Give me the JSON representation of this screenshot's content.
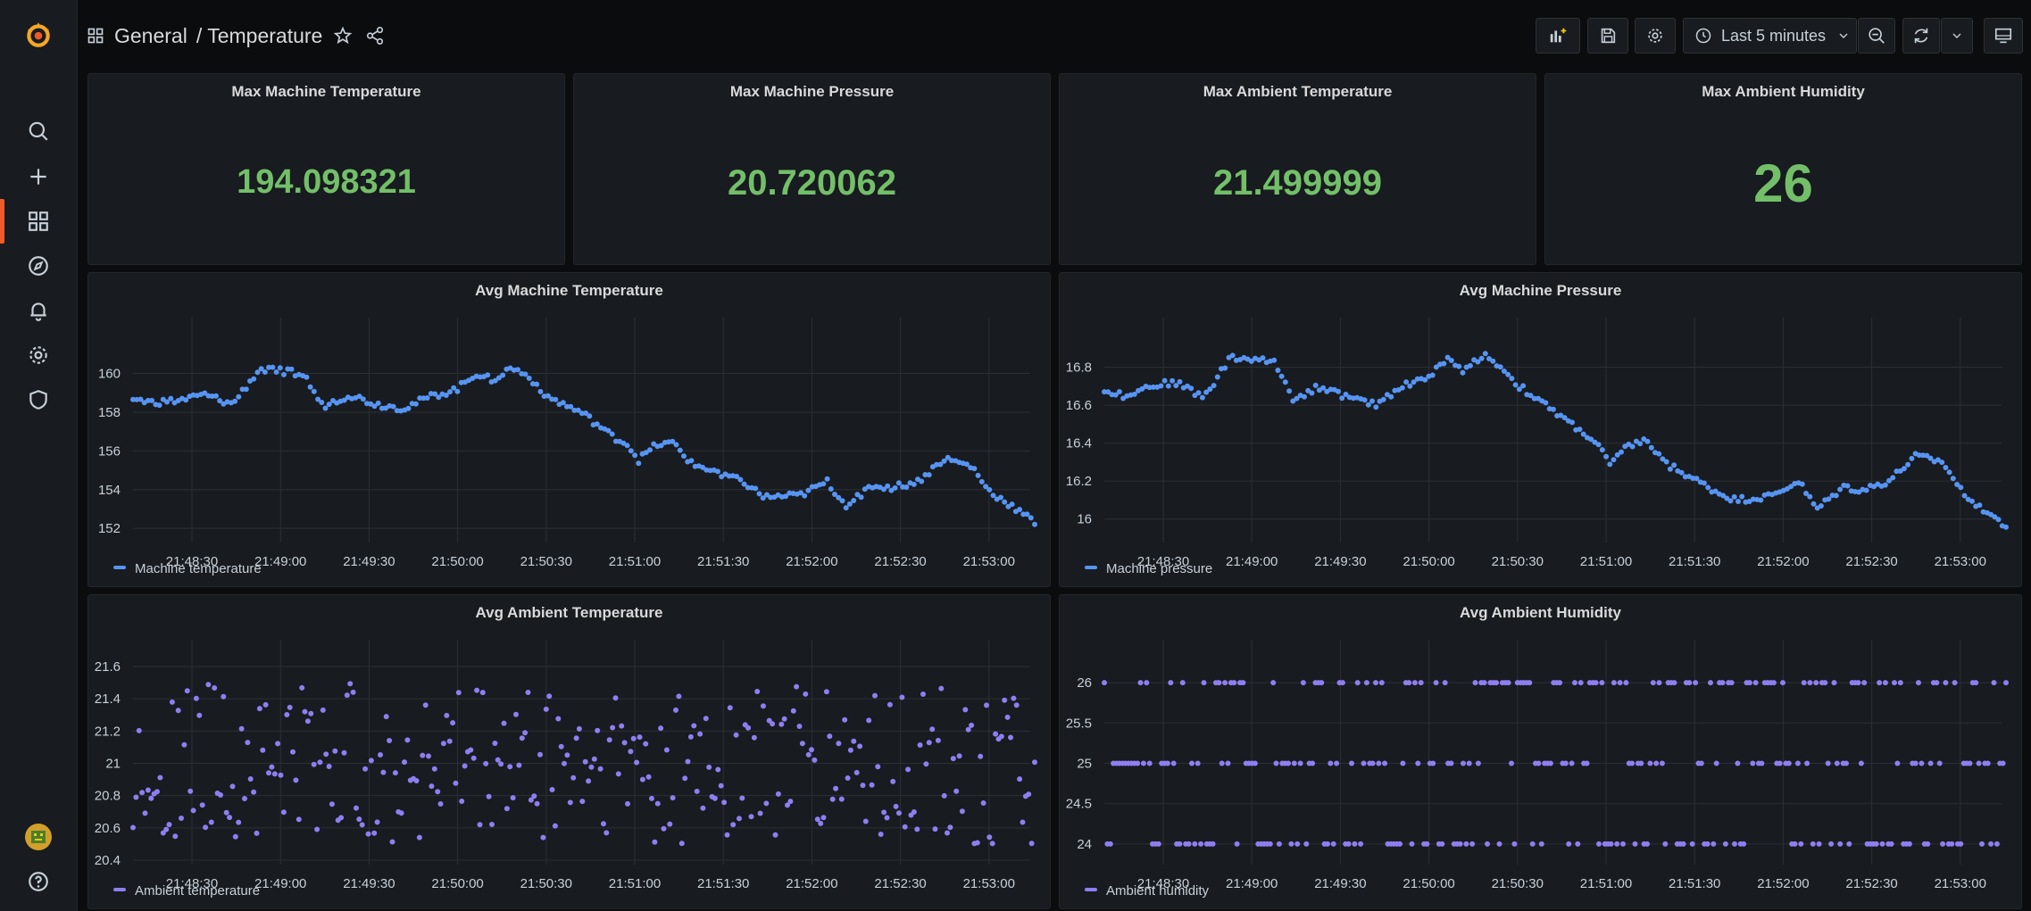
{
  "header": {
    "breadcrumb_folder": "General",
    "breadcrumb_separator": "/",
    "dashboard_title": "Temperature",
    "time_range_label": "Last 5 minutes"
  },
  "icons": {
    "logo": "grafana-logo",
    "search": "search-icon",
    "create": "plus-icon",
    "dashboards": "dashboards-grid-icon",
    "explore": "compass-icon",
    "alerting": "bell-icon",
    "configuration": "gear-icon",
    "server_admin": "shield-icon",
    "help": "question-icon"
  },
  "colors": {
    "stat_value": "#73bf69",
    "series_blue": "#5794f2",
    "series_purple": "#8f7ef2",
    "accent": "#f05a28"
  },
  "stats": [
    {
      "title": "Max Machine Temperature",
      "value": "194.098321"
    },
    {
      "title": "Max Machine Pressure",
      "value": "20.720062"
    },
    {
      "title": "Max Ambient Temperature",
      "value": "21.499999"
    },
    {
      "title": "Max Ambient Humidity",
      "value": "26"
    }
  ],
  "chart_data": [
    {
      "type": "scatter",
      "title": "Avg Machine Temperature",
      "x_ticks": [
        "21:48:30",
        "21:49:00",
        "21:49:30",
        "21:50:00",
        "21:50:30",
        "21:51:00",
        "21:51:30",
        "21:52:00",
        "21:52:30",
        "21:53:00"
      ],
      "y_ticks": [
        160,
        158,
        156,
        154,
        152
      ],
      "ylim": [
        151.5,
        161.5
      ],
      "grid": true,
      "legend_position": "bottom-left",
      "series": [
        {
          "name": "Machine temperature",
          "color": "#5794f2",
          "anchors": [
            [
              0,
              158.7
            ],
            [
              0.02,
              158.5
            ],
            [
              0.05,
              158.6
            ],
            [
              0.08,
              158.9
            ],
            [
              0.11,
              158.4
            ],
            [
              0.14,
              160.2
            ],
            [
              0.17,
              160.1
            ],
            [
              0.19,
              159.9
            ],
            [
              0.21,
              158.3
            ],
            [
              0.24,
              158.9
            ],
            [
              0.27,
              158.4
            ],
            [
              0.3,
              158.2
            ],
            [
              0.33,
              158.8
            ],
            [
              0.36,
              159.2
            ],
            [
              0.38,
              160
            ],
            [
              0.4,
              159.7
            ],
            [
              0.42,
              160.3
            ],
            [
              0.44,
              159.8
            ],
            [
              0.46,
              158.8
            ],
            [
              0.5,
              157.9
            ],
            [
              0.53,
              156.8
            ],
            [
              0.55,
              156.3
            ],
            [
              0.56,
              155.5
            ],
            [
              0.58,
              156.3
            ],
            [
              0.6,
              156.4
            ],
            [
              0.62,
              155.3
            ],
            [
              0.65,
              154.9
            ],
            [
              0.68,
              154.3
            ],
            [
              0.7,
              153.6
            ],
            [
              0.74,
              153.7
            ],
            [
              0.77,
              154.4
            ],
            [
              0.79,
              153.2
            ],
            [
              0.82,
              154.2
            ],
            [
              0.84,
              154.1
            ],
            [
              0.87,
              154.4
            ],
            [
              0.9,
              155.6
            ],
            [
              0.93,
              155.2
            ],
            [
              0.95,
              153.9
            ],
            [
              0.97,
              153.3
            ],
            [
              1,
              152.3
            ]
          ]
        }
      ]
    },
    {
      "type": "scatter",
      "title": "Avg Machine Pressure",
      "x_ticks": [
        "21:48:30",
        "21:49:00",
        "21:49:30",
        "21:50:00",
        "21:50:30",
        "21:51:00",
        "21:51:30",
        "21:52:00",
        "21:52:30",
        "21:53:00"
      ],
      "y_ticks": [
        16.8,
        16.6,
        16.4,
        16.2,
        16
      ],
      "ylim": [
        15.9,
        16.92
      ],
      "grid": true,
      "legend_position": "bottom-left",
      "series": [
        {
          "name": "Machine pressure",
          "color": "#5794f2",
          "anchors": [
            [
              0,
              16.68
            ],
            [
              0.02,
              16.65
            ],
            [
              0.05,
              16.7
            ],
            [
              0.08,
              16.72
            ],
            [
              0.11,
              16.64
            ],
            [
              0.14,
              16.85
            ],
            [
              0.17,
              16.84
            ],
            [
              0.19,
              16.82
            ],
            [
              0.21,
              16.63
            ],
            [
              0.24,
              16.7
            ],
            [
              0.27,
              16.64
            ],
            [
              0.3,
              16.6
            ],
            [
              0.33,
              16.7
            ],
            [
              0.36,
              16.75
            ],
            [
              0.38,
              16.84
            ],
            [
              0.4,
              16.78
            ],
            [
              0.42,
              16.87
            ],
            [
              0.44,
              16.8
            ],
            [
              0.46,
              16.7
            ],
            [
              0.5,
              16.56
            ],
            [
              0.53,
              16.46
            ],
            [
              0.55,
              16.38
            ],
            [
              0.56,
              16.28
            ],
            [
              0.58,
              16.38
            ],
            [
              0.6,
              16.42
            ],
            [
              0.62,
              16.3
            ],
            [
              0.65,
              16.22
            ],
            [
              0.68,
              16.14
            ],
            [
              0.7,
              16.1
            ],
            [
              0.74,
              16.12
            ],
            [
              0.77,
              16.2
            ],
            [
              0.79,
              16.05
            ],
            [
              0.82,
              16.17
            ],
            [
              0.84,
              16.15
            ],
            [
              0.87,
              16.2
            ],
            [
              0.9,
              16.33
            ],
            [
              0.93,
              16.3
            ],
            [
              0.95,
              16.15
            ],
            [
              0.97,
              16.07
            ],
            [
              1,
              15.96
            ]
          ]
        }
      ]
    },
    {
      "type": "scatter",
      "title": "Avg Ambient Temperature",
      "x_ticks": [
        "21:48:30",
        "21:49:00",
        "21:49:30",
        "21:50:00",
        "21:50:30",
        "21:51:00",
        "21:51:30",
        "21:52:00",
        "21:52:30",
        "21:53:00"
      ],
      "y_ticks": [
        21.6,
        21.4,
        21.2,
        21,
        20.8,
        20.6,
        20.4
      ],
      "ylim": [
        20.4,
        21.6
      ],
      "grid": true,
      "legend_position": "bottom-left",
      "series": [
        {
          "name": "Ambient temperature",
          "color": "#8f7ef2",
          "range": [
            20.5,
            21.5
          ],
          "count": 300
        }
      ]
    },
    {
      "type": "scatter",
      "title": "Avg Ambient Humidity",
      "x_ticks": [
        "21:48:30",
        "21:49:00",
        "21:49:30",
        "21:50:00",
        "21:50:30",
        "21:51:00",
        "21:51:30",
        "21:52:00",
        "21:52:30",
        "21:53:00"
      ],
      "y_ticks": [
        26,
        25.5,
        25,
        24.5,
        24
      ],
      "ylim": [
        23.8,
        26.2
      ],
      "grid": true,
      "legend_position": "bottom-left",
      "series": [
        {
          "name": "Ambient humidity",
          "color": "#8f7ef2",
          "levels": [
            24,
            25,
            26
          ],
          "count": 300
        }
      ]
    }
  ]
}
